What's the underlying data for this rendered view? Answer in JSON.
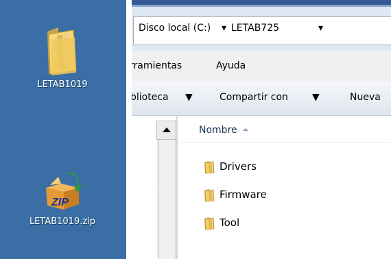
{
  "desktop": {
    "icons": [
      {
        "label": "LETAB1019",
        "icon": "folder-icon"
      },
      {
        "label": "LETAB1019.zip",
        "icon": "zip-archive-icon"
      }
    ]
  },
  "explorer": {
    "breadcrumb": [
      {
        "label": "Disco local (C:)"
      },
      {
        "label": "LETAB725"
      }
    ],
    "menu": [
      "rramientas",
      "Ayuda"
    ],
    "toolbar": [
      "blioteca",
      "Compartir con",
      "Nueva"
    ],
    "column_header": "Nombre",
    "files": [
      {
        "name": "Drivers",
        "icon": "folder-icon"
      },
      {
        "name": "Firmware",
        "icon": "folder-icon"
      },
      {
        "name": "Tool",
        "icon": "folder-icon"
      }
    ]
  },
  "colors": {
    "desktop_bg": "#3a6ea5",
    "title_bar": "#345995",
    "address_bg": "#dfe9f5",
    "folder": "#e8c45a"
  }
}
